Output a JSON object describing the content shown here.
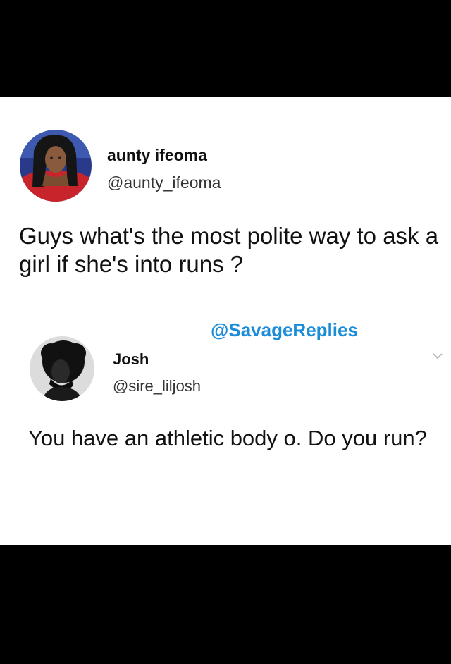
{
  "tweet1": {
    "display_name": "aunty ifeoma",
    "handle": "@aunty_ifeoma",
    "text": "Guys what's the most polite way to ask a girl if she's into runs ?"
  },
  "watermark": "@SavageReplies",
  "tweet2": {
    "display_name": "Josh",
    "handle": "@sire_liljosh",
    "text": "You have an athletic body o. Do you run?"
  },
  "icons": {
    "menu": "chevron-down-icon"
  },
  "colors": {
    "watermark": "#1a8cd8",
    "background_bars": "#000000",
    "card": "#ffffff"
  }
}
